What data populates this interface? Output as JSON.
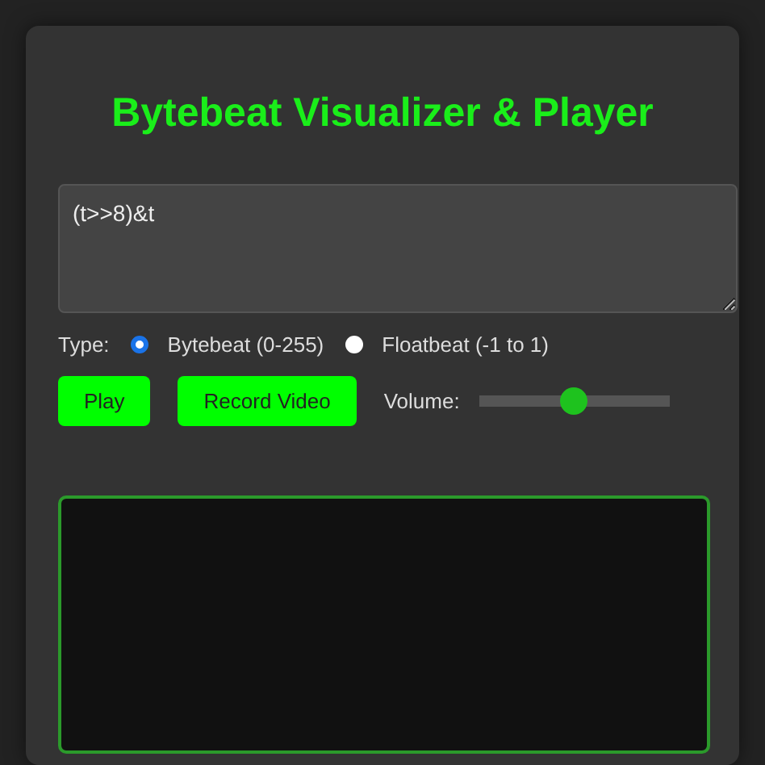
{
  "title": "Bytebeat Visualizer & Player",
  "expression": {
    "value": "(t>>8)&t"
  },
  "type": {
    "label": "Type:",
    "options": [
      {
        "label": "Bytebeat (0-255)",
        "selected": true
      },
      {
        "label": "Floatbeat (-1 to 1)",
        "selected": false
      }
    ]
  },
  "buttons": [
    {
      "label": "Play"
    },
    {
      "label": "Record Video"
    }
  ],
  "volume": {
    "label": "Volume:",
    "level": 0.49
  }
}
